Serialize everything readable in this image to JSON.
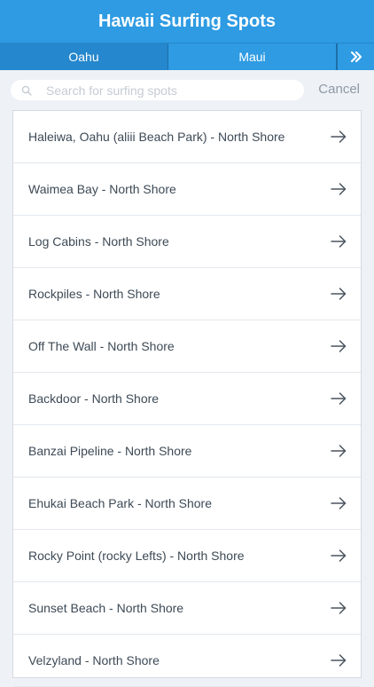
{
  "header": {
    "title": "Hawaii Surfing Spots"
  },
  "tabs": [
    {
      "label": "Oahu",
      "active": true
    },
    {
      "label": "Maui",
      "active": false
    }
  ],
  "search": {
    "placeholder": "Search for surfing spots",
    "value": "",
    "cancel_label": "Cancel"
  },
  "spots": [
    {
      "label": "Haleiwa, Oahu (aliii Beach Park) - North Shore"
    },
    {
      "label": "Waimea Bay - North Shore"
    },
    {
      "label": "Log Cabins - North Shore"
    },
    {
      "label": "Rockpiles - North Shore"
    },
    {
      "label": "Off The Wall - North Shore"
    },
    {
      "label": "Backdoor - North Shore"
    },
    {
      "label": "Banzai Pipeline - North Shore"
    },
    {
      "label": "Ehukai Beach Park - North Shore"
    },
    {
      "label": "Rocky Point (rocky Lefts) - North Shore"
    },
    {
      "label": "Sunset Beach - North Shore"
    },
    {
      "label": "Velzyland - North Shore"
    }
  ],
  "icons": {
    "more": "chevron-right-double-icon",
    "search": "search-icon",
    "row_action": "arrow-right-icon"
  },
  "colors": {
    "header_bg": "#2e9be3",
    "active_tab_bg": "#2587cd",
    "page_bg": "#eef2f7",
    "row_text": "#3d4a56"
  }
}
